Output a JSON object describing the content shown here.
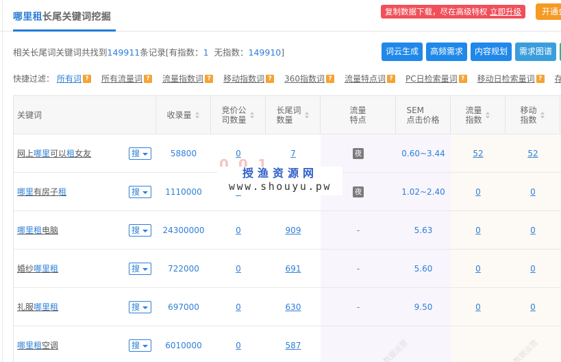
{
  "header": {
    "title_keyword": "哪里租",
    "title_suffix": "长尾关键词挖掘",
    "promo_text": "复制数据下载，尽在高级特权 ",
    "promo_link": "立即升级",
    "open_button": "开通会员"
  },
  "summary": {
    "prefix": "相关长尾词关键词共找到",
    "total": "149911",
    "mid": "条记录[有指数：",
    "with_index": "1",
    "mid2": "  无指数：",
    "without_index": "149910",
    "suffix": "]"
  },
  "actions": [
    "词云生成",
    "高频需求",
    "内容规划",
    "需求图谱",
    ""
  ],
  "filters": {
    "label": "快捷过滤：",
    "items": [
      "所有词",
      "所有流量词",
      "流量指数词",
      "移动指数词",
      "360指数词",
      "流量特点词",
      "PC日检索量词",
      "移动日检索量词",
      "存"
    ],
    "active": "所有词",
    "help_glyph": "?"
  },
  "table": {
    "columns": {
      "keyword": "关键词",
      "indexed": "收录量",
      "bid_companies": "竞价公\n司数量",
      "longtail_count": "长尾词\n数量",
      "traffic_feature": "流量\n特点",
      "sem_price": "SEM\n点击价格",
      "traffic_index": "流量\n指数",
      "mobile_index": "移动\n指数"
    },
    "search_button": "搜",
    "rows": [
      {
        "keyword_parts": [
          [
            "网上",
            0
          ],
          [
            "哪里",
            1
          ],
          [
            "可以",
            0
          ],
          [
            "租",
            1
          ],
          [
            "女友",
            0
          ]
        ],
        "indexed": "58800",
        "bid_companies": "0",
        "longtail_count": "7",
        "traffic_feature": "夜",
        "sem_price": "0.60~3.44",
        "traffic_index": "52",
        "mobile_index": "52"
      },
      {
        "keyword_parts": [
          [
            "哪里",
            1
          ],
          [
            "有房子",
            0
          ],
          [
            "租",
            1
          ]
        ],
        "indexed": "1110000",
        "bid_companies": "0",
        "longtail_count": "",
        "traffic_feature": "夜",
        "sem_price": "1.02~2.40",
        "traffic_index": "0",
        "mobile_index": "0"
      },
      {
        "keyword_parts": [
          [
            "哪里租",
            1
          ],
          [
            "电脑",
            0
          ]
        ],
        "indexed": "24300000",
        "bid_companies": "0",
        "longtail_count": "909",
        "traffic_feature": "-",
        "sem_price": "5.63",
        "traffic_index": "0",
        "mobile_index": "0"
      },
      {
        "keyword_parts": [
          [
            "婚纱",
            0
          ],
          [
            "哪里租",
            1
          ]
        ],
        "indexed": "722000",
        "bid_companies": "0",
        "longtail_count": "691",
        "traffic_feature": "-",
        "sem_price": "5.60",
        "traffic_index": "0",
        "mobile_index": "0"
      },
      {
        "keyword_parts": [
          [
            "礼服",
            0
          ],
          [
            "哪里租",
            1
          ]
        ],
        "indexed": "697000",
        "bid_companies": "0",
        "longtail_count": "630",
        "traffic_feature": "-",
        "sem_price": "9.50",
        "traffic_index": "0",
        "mobile_index": "0"
      },
      {
        "keyword_parts": [
          [
            "哪里租",
            1
          ],
          [
            "空调",
            0
          ]
        ],
        "indexed": "6010000",
        "bid_companies": "0",
        "longtail_count": "587",
        "traffic_feature": "",
        "sem_price": "",
        "traffic_index": "",
        "mobile_index": ""
      }
    ]
  },
  "watermark": {
    "site_name": "授渔资源网",
    "site_url": "www.shouyu.pw",
    "faint_text": "数据运营"
  },
  "colors": {
    "accent": "#2d7fd6",
    "promo": "#f0505a",
    "open": "#f59a23",
    "action": "#1f88e9",
    "help": "#f5a335"
  }
}
